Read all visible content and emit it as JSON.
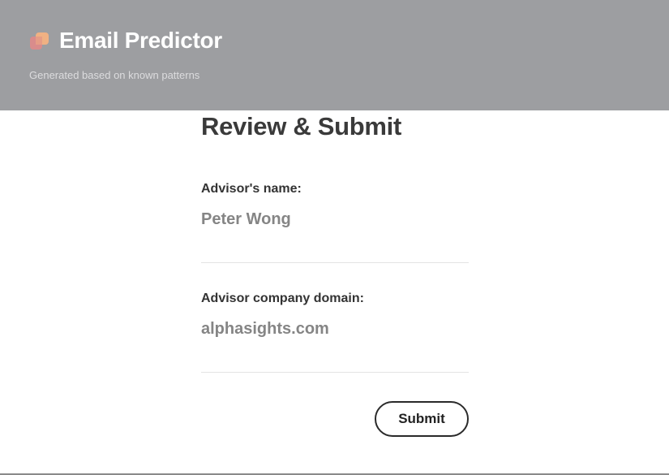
{
  "header": {
    "title": "Email Predictor",
    "subtitle": "Generated based on known patterns",
    "logo_icon": "overlapping-squares-logo-icon"
  },
  "review": {
    "title": "Review & Submit",
    "fields": [
      {
        "label": "Advisor's name:",
        "value": "Peter Wong"
      },
      {
        "label": "Advisor company domain:",
        "value": "alphasights.com"
      }
    ],
    "submit_label": "Submit"
  },
  "colors": {
    "header_background": "#9d9ea1",
    "header_text": "#ffffff",
    "logo_front": "#f0b183",
    "logo_back": "#d98c8c",
    "heading_text": "#3a3a3a",
    "value_text": "#858585",
    "divider": "#e3e3e3",
    "button_border": "#2a2a2a"
  }
}
